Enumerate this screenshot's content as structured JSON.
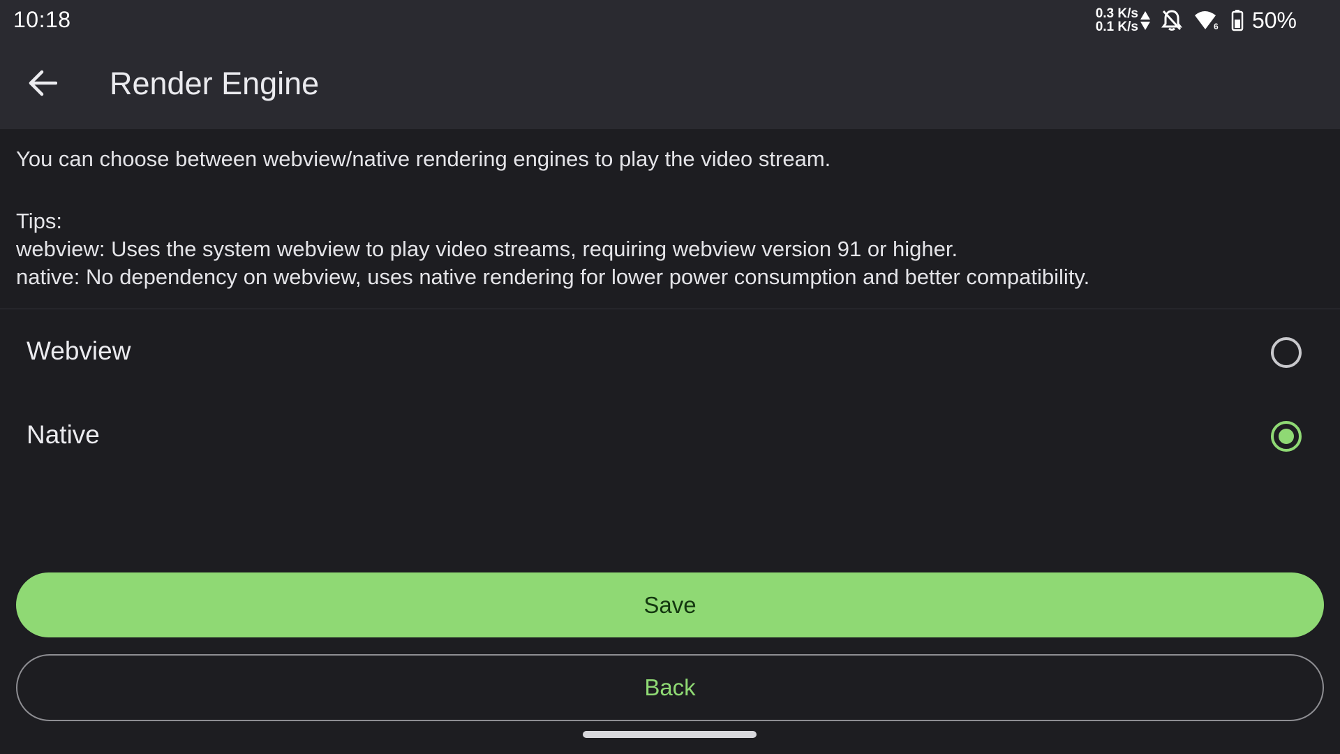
{
  "status_bar": {
    "time": "10:18",
    "upload_speed": "0.3 K/s",
    "download_speed": "0.1 K/s",
    "battery_percent": "50%",
    "icons": [
      "upload-arrow-icon",
      "download-arrow-icon",
      "notifications-off-icon",
      "wifi-6-icon",
      "battery-icon"
    ]
  },
  "app_bar": {
    "title": "Render Engine",
    "back_icon": "arrow-left-icon"
  },
  "description": {
    "intro": "You can choose between webview/native rendering engines to play the video stream.",
    "tips_heading": "Tips:",
    "tip_webview": "webview: Uses the system webview to play video streams, requiring webview version 91 or higher.",
    "tip_native": "native: No dependency on webview, uses native rendering for lower power consumption and better compatibility."
  },
  "options": {
    "selected": "Native",
    "items": [
      {
        "label": "Webview",
        "checked": false
      },
      {
        "label": "Native",
        "checked": true
      }
    ]
  },
  "actions": {
    "save_label": "Save",
    "back_label": "Back"
  },
  "colors": {
    "accent": "#8fd974",
    "background": "#1d1d21",
    "surface": "#2a2a30",
    "text": "#e6e6ea",
    "save_text": "#143810"
  }
}
